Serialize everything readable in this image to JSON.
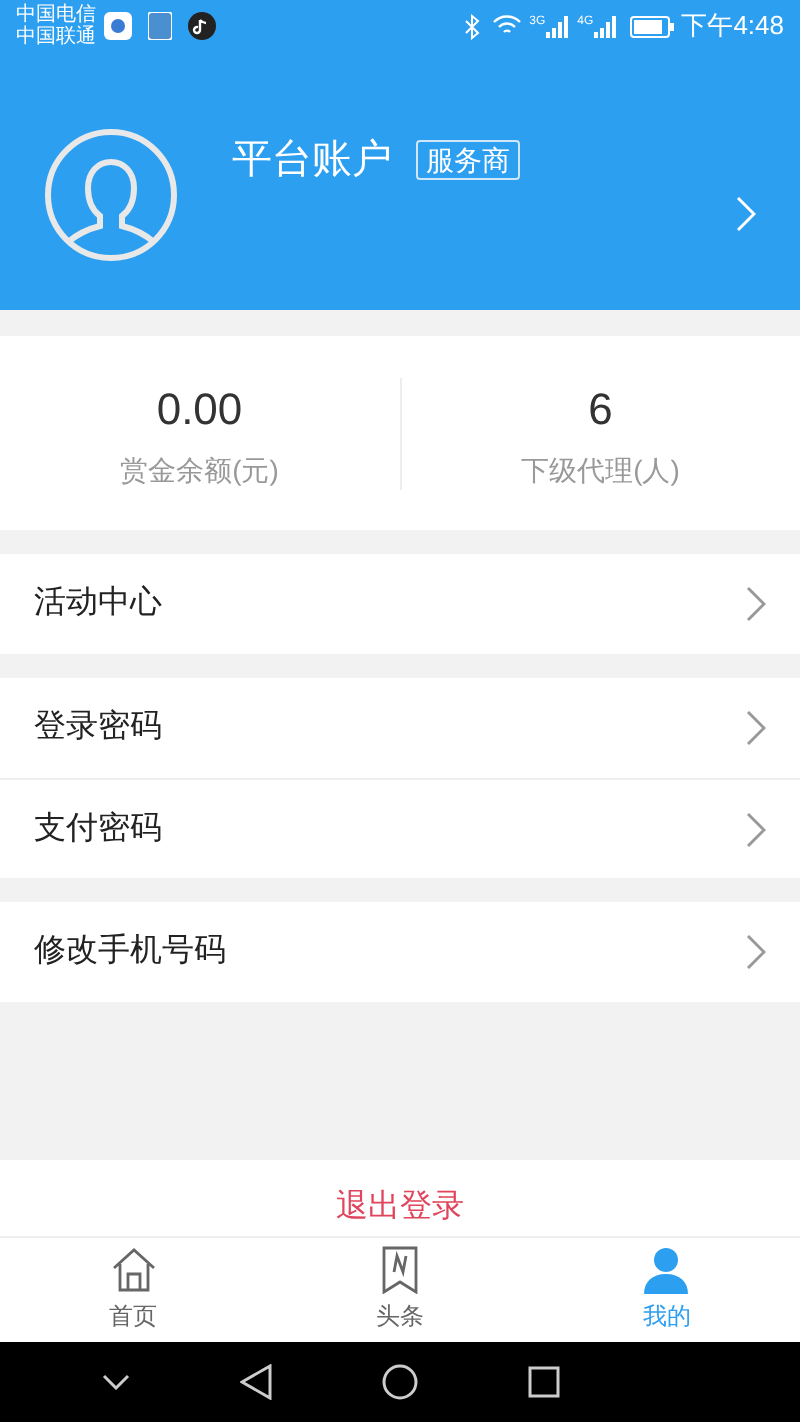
{
  "status_bar": {
    "carriers": [
      "中国电信",
      "中国联通"
    ],
    "network_labels": [
      "3G",
      "4G"
    ],
    "time": "下午4:48"
  },
  "profile": {
    "name": "平台账户",
    "badge": "服务商"
  },
  "stats": [
    {
      "value": "0.00",
      "label": "赏金余额(元)"
    },
    {
      "value": "6",
      "label": "下级代理(人)"
    }
  ],
  "menu_groups": [
    [
      "活动中心"
    ],
    [
      "登录密码",
      "支付密码"
    ],
    [
      "修改手机号码"
    ]
  ],
  "logout": "退出登录",
  "bottom_nav": [
    {
      "label": "首页",
      "kind": "home",
      "selected": false
    },
    {
      "label": "头条",
      "kind": "news",
      "selected": false
    },
    {
      "label": "我的",
      "kind": "user",
      "selected": true
    }
  ]
}
